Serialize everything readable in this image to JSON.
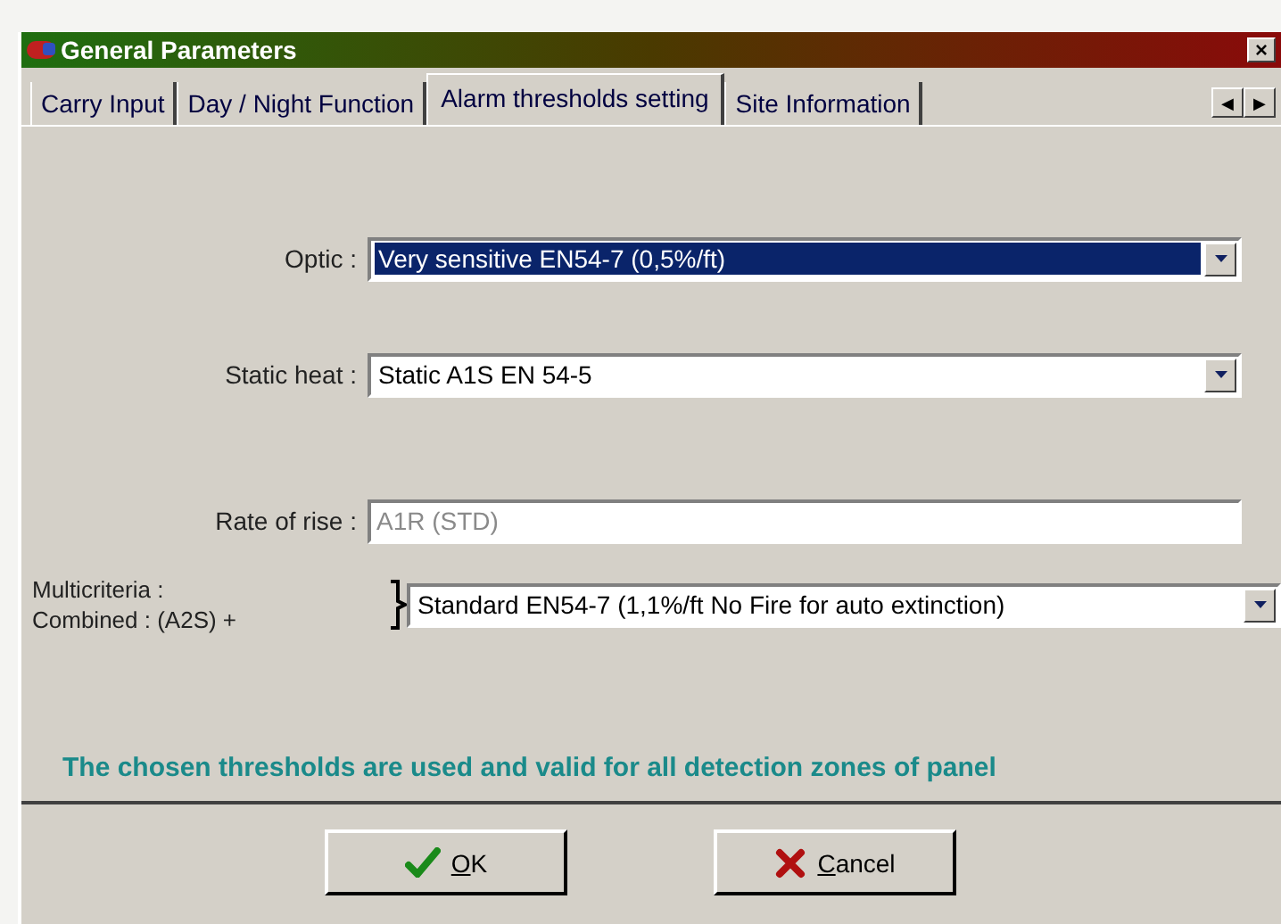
{
  "window": {
    "title": "General Parameters",
    "close": "×"
  },
  "tabs": [
    {
      "label": "Carry Input",
      "selected": false
    },
    {
      "label": "Day / Night Function",
      "selected": false
    },
    {
      "label": "Alarm thresholds setting",
      "selected": true
    },
    {
      "label": "Site Information",
      "selected": false
    }
  ],
  "tab_scroll": [
    "◀",
    "▶"
  ],
  "fields": [
    {
      "kind": "dropdown",
      "label_lines": [
        "Optic :"
      ],
      "value": "Very sensitive EN54-7 (0,5%/ft)",
      "focused": true,
      "disabled": false
    },
    {
      "kind": "dropdown",
      "label_lines": [
        "Static heat :"
      ],
      "value": "Static A1S EN 54-5",
      "focused": false,
      "disabled": false
    },
    {
      "kind": "text",
      "label_lines": [
        "Rate of rise :"
      ],
      "value": "A1R (STD)",
      "focused": false,
      "disabled": true
    },
    {
      "kind": "dropdown",
      "label_lines": [
        "Multicriteria :",
        "Combined : (A2S) +"
      ],
      "value": "Standard EN54-7 (1,1%/ft No Fire for auto extinction)",
      "focused": false,
      "disabled": false
    }
  ],
  "note": "The chosen thresholds are used and valid for all detection zones of panel",
  "buttons": [
    {
      "kind": "ok",
      "mnemonic": "O",
      "label_rest": "K"
    },
    {
      "kind": "cancel",
      "mnemonic": "C",
      "label_rest": "ancel"
    }
  ]
}
